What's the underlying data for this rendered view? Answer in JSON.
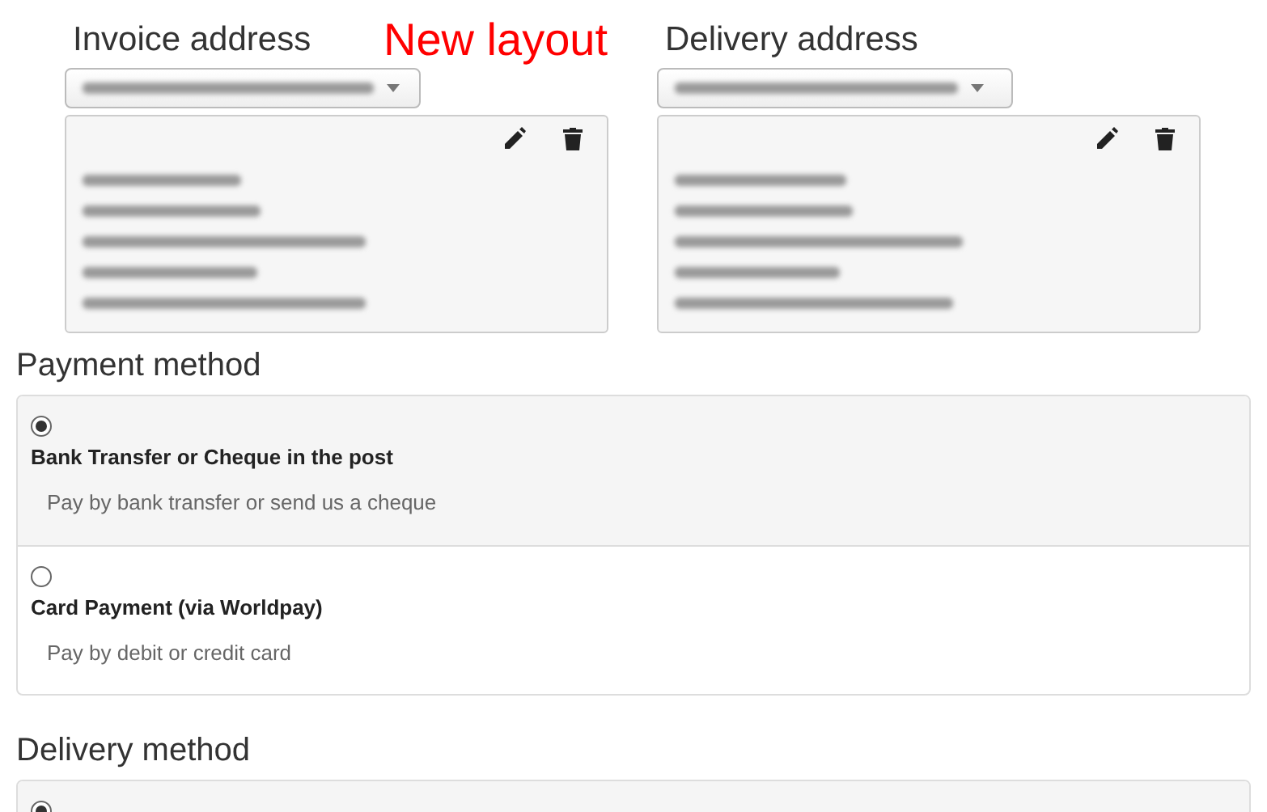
{
  "addresses": [
    {
      "title": "Invoice address",
      "kind": "invoice"
    },
    {
      "title": "Delivery address",
      "kind": "delivery"
    }
  ],
  "note": "New layout",
  "payment": {
    "title": "Payment method",
    "options": [
      {
        "label": "Bank Transfer or Cheque in the post",
        "description": "Pay by bank transfer or send us a cheque",
        "selected": true
      },
      {
        "label": "Card Payment (via Worldpay)",
        "description": "Pay by debit or credit card",
        "selected": false
      }
    ]
  },
  "delivery": {
    "title": "Delivery method",
    "options": [
      {
        "selected": true
      }
    ]
  }
}
